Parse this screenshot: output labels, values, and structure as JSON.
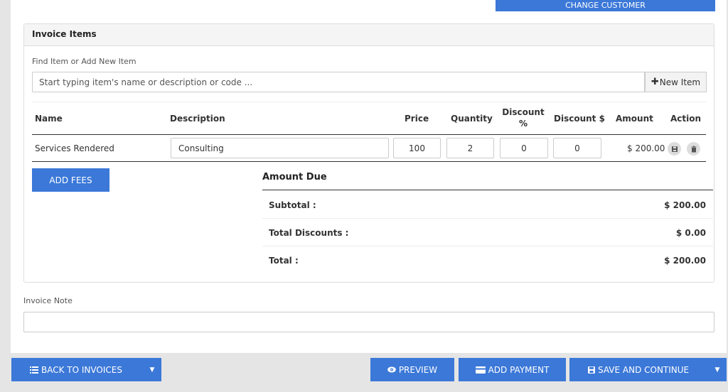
{
  "header": {
    "change_customer_label": "CHANGE CUSTOMER"
  },
  "invoice_items": {
    "title": "Invoice Items",
    "find_label": "Find Item or Add New Item",
    "search_placeholder": "Start typing item's name or description or code ...",
    "new_item_label": "New Item",
    "columns": [
      "Name",
      "Description",
      "Price",
      "Quantity",
      "Discount %",
      "Discount $",
      "Amount",
      "Action"
    ],
    "rows": [
      {
        "name": "Services Rendered",
        "description": "Consulting",
        "price": "100",
        "quantity": "2",
        "discount_percent": "0",
        "discount_amount": "0",
        "amount": "$ 200.00"
      }
    ],
    "add_fees_label": "ADD FEES"
  },
  "amount_due": {
    "title": "Amount Due",
    "subtotal_label": "Subtotal :",
    "subtotal_value": "$ 200.00",
    "total_discounts_label": "Total Discounts :",
    "total_discounts_value": "$ 0.00",
    "total_label": "Total :",
    "total_value": "$ 200.00"
  },
  "invoice_note": {
    "label": "Invoice Note",
    "value": ""
  },
  "footer": {
    "back_label": "BACK TO INVOICES",
    "preview_label": "PREVIEW",
    "add_payment_label": "ADD PAYMENT",
    "save_continue_label": "SAVE AND CONTINUE"
  },
  "colors": {
    "accent": "#3b78d8",
    "background": "#e5e5e5"
  },
  "icons": [
    "plus-icon",
    "save-icon",
    "trash-icon",
    "list-icon",
    "caret-down-icon",
    "eye-icon",
    "credit-card-icon"
  ]
}
